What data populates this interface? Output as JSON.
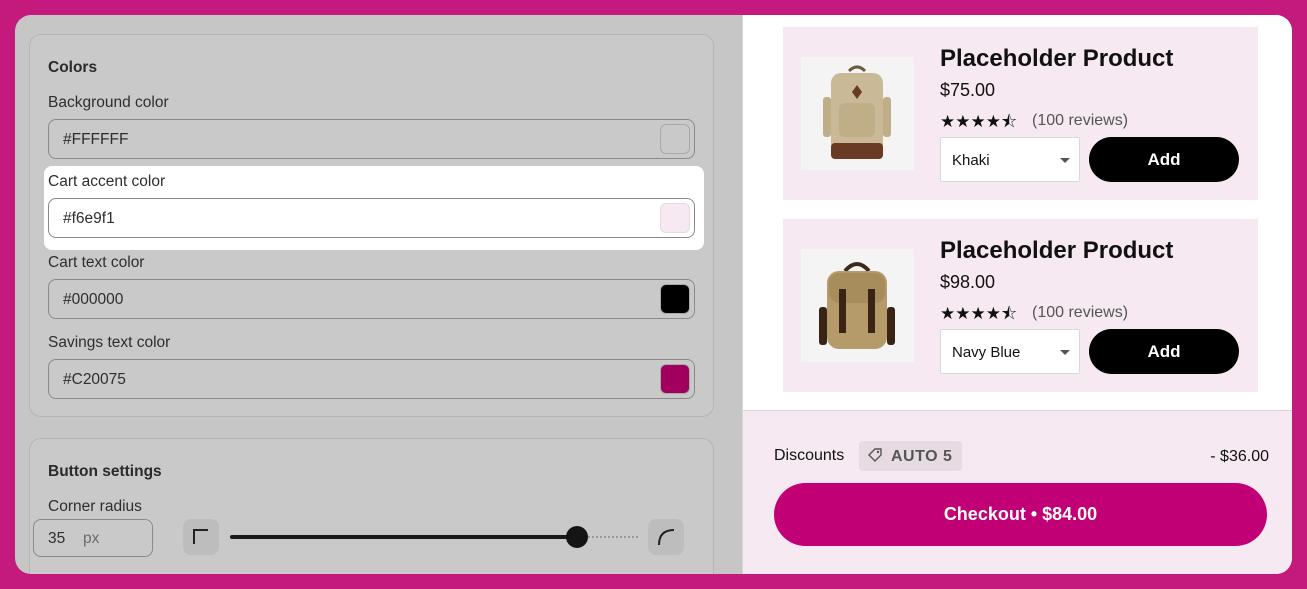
{
  "settings": {
    "colors": {
      "title": "Colors",
      "fields": [
        {
          "label": "Background color",
          "value": "#FFFFFF",
          "swatch": "#ffffff"
        },
        {
          "label": "Cart accent color",
          "value": "#f6e9f1",
          "swatch": "#f6e9f1"
        },
        {
          "label": "Cart text color",
          "value": "#000000",
          "swatch": "#000000"
        },
        {
          "label": "Savings text color",
          "value": "#C20075",
          "swatch": "#c20075"
        }
      ]
    },
    "buttons": {
      "title": "Button settings",
      "corner_radius_label": "Corner radius",
      "corner_radius_value": "35",
      "corner_radius_unit": "px",
      "slider_fraction": 0.85
    }
  },
  "cart": {
    "products": [
      {
        "name": "Placeholder Product",
        "price": "$75.00",
        "stars": "★★★★⯪",
        "reviews": "(100 reviews)",
        "variant": "Khaki",
        "add_label": "Add",
        "image": "khaki-backpack"
      },
      {
        "name": "Placeholder Product",
        "price": "$98.00",
        "stars": "★★★★⯪",
        "reviews": "(100 reviews)",
        "variant": "Navy Blue",
        "add_label": "Add",
        "image": "flap-backpack"
      }
    ],
    "discounts_label": "Discounts",
    "discount_code": "AUTO 5",
    "discount_amount": "- $36.00",
    "checkout_label": "Checkout • $84.00",
    "accent_color": "#c20075",
    "panel_color": "#f6e9f1"
  }
}
